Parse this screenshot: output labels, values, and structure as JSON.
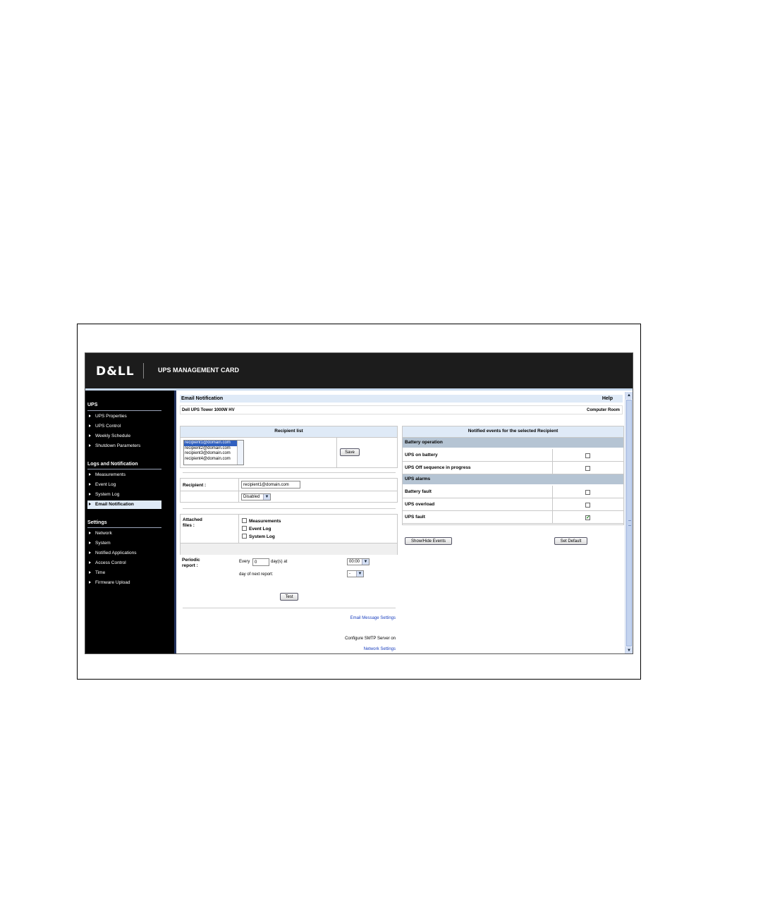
{
  "header": {
    "logo": "D&LL",
    "title": "UPS MANAGEMENT CARD"
  },
  "sidebar": {
    "sections": [
      {
        "heading": "UPS",
        "items": [
          "UPS Properties",
          "UPS Control",
          "Weekly Schedule",
          "Shutdown Parameters"
        ]
      },
      {
        "heading": "Logs and Notification",
        "items": [
          "Measurements",
          "Event Log",
          "System Log",
          "Email Notification"
        ]
      },
      {
        "heading": "Settings",
        "items": [
          "Network",
          "System",
          "Notified Applications",
          "Access Control",
          "Time",
          "Firmware Upload"
        ]
      }
    ],
    "active_item": "Email Notification"
  },
  "page": {
    "title": "Email Notification",
    "help": "Help",
    "device": "Dell UPS Tower 1000W HV",
    "location": "Computer Room"
  },
  "recipient_list": {
    "header": "Recipient list",
    "options": [
      "recipient1@domain.com",
      "recipient2@domain.com",
      "recipient3@domain.com",
      "recipient4@domain.com"
    ],
    "selected": "recipient1@domain.com",
    "save_label": "Save"
  },
  "recipient": {
    "label": "Recipient :",
    "value": "recipient1@domain.com",
    "status": "Disabled"
  },
  "attached": {
    "label": "Attached files :",
    "items": [
      {
        "label": "Measurements",
        "checked": false
      },
      {
        "label": "Event Log",
        "checked": false
      },
      {
        "label": "System Log",
        "checked": false
      }
    ]
  },
  "periodic": {
    "label": "Periodic report :",
    "every_label": "Every",
    "days_value": "0",
    "days_label": "day(s) at",
    "time_value": "00:00",
    "next_label": "day of next report:",
    "next_value": "-",
    "test_label": "Test"
  },
  "links": {
    "email_settings": "Email Message Settings",
    "smtp_text": "Configure SMTP Server on",
    "network_settings": "Network Settings"
  },
  "events": {
    "header": "Notified events for the selected Recipient",
    "groups": [
      {
        "name": "Battery operation",
        "rows": [
          {
            "name": "UPS on battery",
            "checked": false
          },
          {
            "name": "UPS Off sequence in progress",
            "checked": false
          }
        ]
      },
      {
        "name": "UPS alarms",
        "rows": [
          {
            "name": "Battery fault",
            "checked": false
          },
          {
            "name": "UPS overload",
            "checked": false
          },
          {
            "name": "UPS fault",
            "checked": true
          }
        ]
      }
    ],
    "show_hide_label": "Show/Hide Events",
    "set_default_label": "Set Default"
  },
  "colors": {
    "topbar": "#1c1c1c",
    "sidebar": "#000000",
    "header_blue": "#dfeaf7",
    "group_row": "#b5c4d3",
    "link": "#1a3fbf"
  }
}
